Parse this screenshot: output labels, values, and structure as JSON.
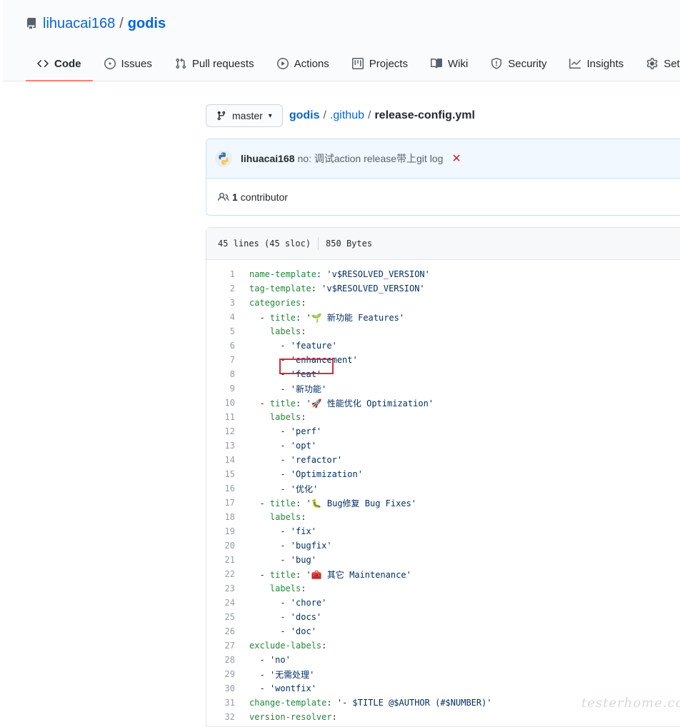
{
  "repo": {
    "owner": "lihuacai168",
    "separator": "/",
    "name": "godis"
  },
  "tabs": [
    {
      "label": "Code",
      "icon": "code-icon",
      "selected": true
    },
    {
      "label": "Issues",
      "icon": "issue-opened-icon"
    },
    {
      "label": "Pull requests",
      "icon": "git-pull-request-icon"
    },
    {
      "label": "Actions",
      "icon": "play-icon"
    },
    {
      "label": "Projects",
      "icon": "project-icon"
    },
    {
      "label": "Wiki",
      "icon": "book-icon"
    },
    {
      "label": "Security",
      "icon": "shield-icon"
    },
    {
      "label": "Insights",
      "icon": "graph-icon"
    },
    {
      "label": "Settings",
      "icon": "gear-icon"
    }
  ],
  "branch": {
    "label": "master"
  },
  "breadcrumb": {
    "root": "godis",
    "dir": ".github",
    "file": "release-config.yml"
  },
  "commit": {
    "author": "lihuacai168",
    "message": "no: 调试action release带上git log",
    "status_icon": "x-icon",
    "status_color": "#cb2431"
  },
  "contributors": {
    "count": "1",
    "label": "contributor"
  },
  "file_info": {
    "lines": "45 lines (45 sloc)",
    "size": "850 Bytes"
  },
  "code_lines": [
    {
      "n": "1",
      "indent": "",
      "key": "name-template",
      "val": "'v$RESOLVED_VERSION'"
    },
    {
      "n": "2",
      "indent": "",
      "key": "tag-template",
      "val": "'v$RESOLVED_VERSION'"
    },
    {
      "n": "3",
      "indent": "",
      "key": "categories",
      "val": ""
    },
    {
      "n": "4",
      "indent": "  - ",
      "key": "title",
      "val": "'🌱 新功能 Features'"
    },
    {
      "n": "5",
      "indent": "    ",
      "key": "labels",
      "val": ""
    },
    {
      "n": "6",
      "indent": "      - ",
      "key": "",
      "val": "'feature'"
    },
    {
      "n": "7",
      "indent": "      - ",
      "key": "",
      "val": "'enhancement'"
    },
    {
      "n": "8",
      "indent": "      - ",
      "key": "",
      "val": "'feat'"
    },
    {
      "n": "9",
      "indent": "      - ",
      "key": "",
      "val": "'新功能'"
    },
    {
      "n": "10",
      "indent": "  - ",
      "key": "title",
      "val": "'🚀 性能优化 Optimization'"
    },
    {
      "n": "11",
      "indent": "    ",
      "key": "labels",
      "val": ""
    },
    {
      "n": "12",
      "indent": "      - ",
      "key": "",
      "val": "'perf'"
    },
    {
      "n": "13",
      "indent": "      - ",
      "key": "",
      "val": "'opt'"
    },
    {
      "n": "14",
      "indent": "      - ",
      "key": "",
      "val": "'refactor'"
    },
    {
      "n": "15",
      "indent": "      - ",
      "key": "",
      "val": "'Optimization'"
    },
    {
      "n": "16",
      "indent": "      - ",
      "key": "",
      "val": "'优化'"
    },
    {
      "n": "17",
      "indent": "  - ",
      "key": "title",
      "val": "'🐛 Bug修复 Bug Fixes'"
    },
    {
      "n": "18",
      "indent": "    ",
      "key": "labels",
      "val": ""
    },
    {
      "n": "19",
      "indent": "      - ",
      "key": "",
      "val": "'fix'"
    },
    {
      "n": "20",
      "indent": "      - ",
      "key": "",
      "val": "'bugfix'"
    },
    {
      "n": "21",
      "indent": "      - ",
      "key": "",
      "val": "'bug'"
    },
    {
      "n": "22",
      "indent": "  - ",
      "key": "title",
      "val": "'🧰 其它 Maintenance'"
    },
    {
      "n": "23",
      "indent": "    ",
      "key": "labels",
      "val": ""
    },
    {
      "n": "24",
      "indent": "      - ",
      "key": "",
      "val": "'chore'"
    },
    {
      "n": "25",
      "indent": "      - ",
      "key": "",
      "val": "'docs'"
    },
    {
      "n": "26",
      "indent": "      - ",
      "key": "",
      "val": "'doc'"
    },
    {
      "n": "27",
      "indent": "",
      "key": "exclude-labels",
      "val": ""
    },
    {
      "n": "28",
      "indent": "  - ",
      "key": "",
      "val": "'no'"
    },
    {
      "n": "29",
      "indent": "  - ",
      "key": "",
      "val": "'无需处理'"
    },
    {
      "n": "30",
      "indent": "  - ",
      "key": "",
      "val": "'wontfix'"
    },
    {
      "n": "31",
      "indent": "",
      "key": "change-template",
      "val": "'- $TITLE @$AUTHOR (#$NUMBER)'"
    },
    {
      "n": "32",
      "indent": "",
      "key": "version-resolver",
      "val": ""
    }
  ],
  "annotation": {
    "highlighted_line": "8",
    "box_color": "#e0282d"
  },
  "watermark": {
    "text": "testerhome.com"
  },
  "colors": {
    "link": "#0366d6",
    "tab_underline": "#f9826c",
    "yaml_key": "#22863a",
    "yaml_string": "#032f62"
  }
}
